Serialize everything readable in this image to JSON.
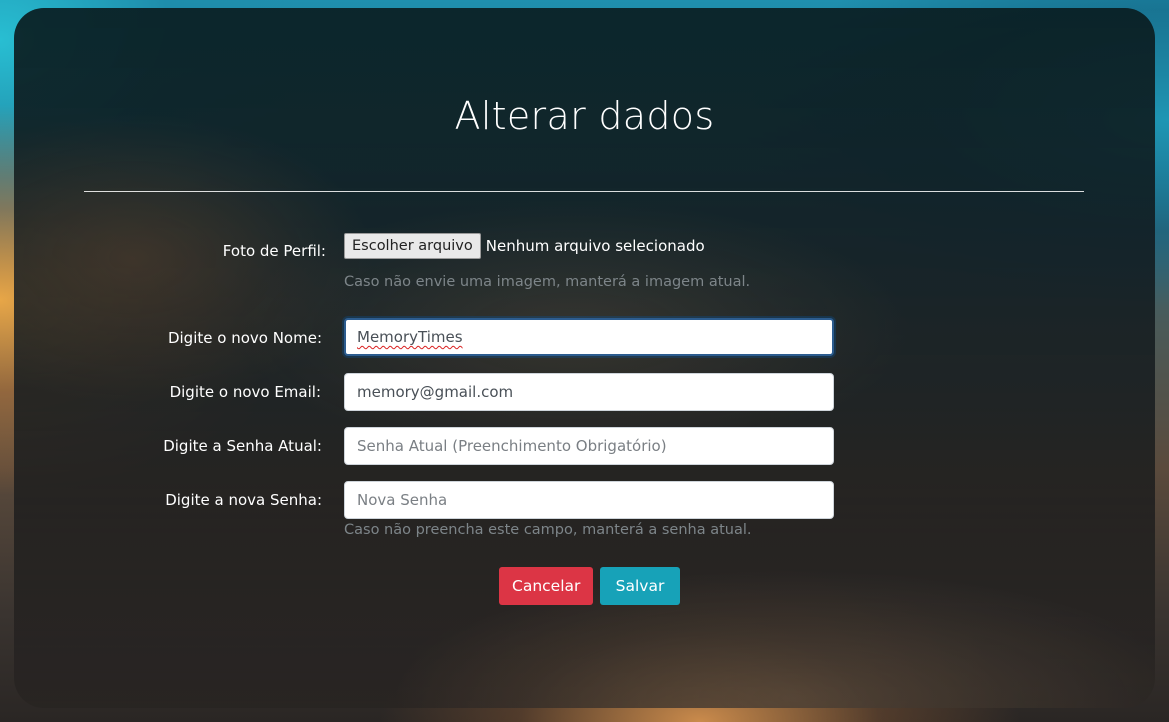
{
  "page": {
    "title": "Alterar dados"
  },
  "form": {
    "photo": {
      "label": "Foto de Perfil:",
      "button_label": "Escolher arquivo",
      "status": "Nenhum arquivo selecionado",
      "help": "Caso não envie uma imagem, manterá a imagem atual."
    },
    "name": {
      "label": "Digite o novo Nome:",
      "value": "MemoryTimes"
    },
    "email": {
      "label": "Digite o novo Email:",
      "value": "memory@gmail.com"
    },
    "current_password": {
      "label": "Digite a Senha Atual:",
      "placeholder": "Senha Atual (Preenchimento Obrigatório)"
    },
    "new_password": {
      "label": "Digite a nova Senha:",
      "placeholder": "Nova Senha",
      "help": "Caso não preencha este campo, manterá a senha atual."
    }
  },
  "actions": {
    "cancel_label": "Cancelar",
    "save_label": "Salvar"
  },
  "colors": {
    "cancel": "#dc3545",
    "save": "#17a2b8",
    "focus_border": "#2c5c8f",
    "help_text": "#7d8589"
  }
}
